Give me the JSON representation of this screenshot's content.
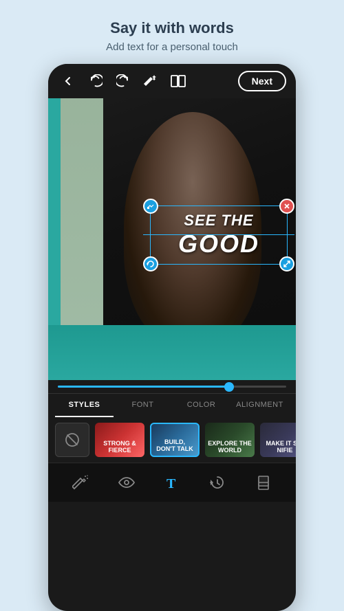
{
  "header": {
    "title": "Say it with words",
    "subtitle": "Add text for a personal touch"
  },
  "toolbar": {
    "back_label": "←",
    "undo_label": "↩",
    "redo_label": "↪",
    "magic_label": "✦",
    "compare_label": "⧉",
    "next_label": "Next"
  },
  "text_overlay": {
    "line1": "SEE THE",
    "line2": "GOOD"
  },
  "slider": {
    "value": 75
  },
  "tabs": [
    {
      "id": "styles",
      "label": "STYLES",
      "active": true
    },
    {
      "id": "font",
      "label": "FONT",
      "active": false
    },
    {
      "id": "color",
      "label": "COLOR",
      "active": false
    },
    {
      "id": "alignment",
      "label": "ALIGNMENT",
      "active": false
    }
  ],
  "style_cards": [
    {
      "id": "none",
      "type": "none",
      "label": ""
    },
    {
      "id": "strong-fierce",
      "type": "card",
      "bg": "1",
      "text": "STRONG &\nFIERCE"
    },
    {
      "id": "build-dont-talk",
      "type": "card",
      "bg": "2",
      "text": "BUILD,\nDON'T TALK",
      "active": true
    },
    {
      "id": "explore-world",
      "type": "card",
      "bg": "3",
      "text": "EXPLORE\nTHE WORLD"
    },
    {
      "id": "make-it",
      "type": "card",
      "bg": "4",
      "text": "MAKE IT SIG\nNIFIE"
    }
  ],
  "bottom_nav": [
    {
      "id": "magic-wand",
      "icon": "wand",
      "active": false
    },
    {
      "id": "eye",
      "icon": "eye",
      "active": false
    },
    {
      "id": "text",
      "icon": "text",
      "active": true
    },
    {
      "id": "history",
      "icon": "history",
      "active": false
    },
    {
      "id": "layers",
      "icon": "layers",
      "active": false
    }
  ],
  "icons": {
    "back": "←",
    "undo": "↩",
    "redo": "↪",
    "edit": "✎",
    "close": "✕",
    "rotate": "↻",
    "resize": "⤢",
    "no_style": "⊘",
    "wand": "✦",
    "eye": "👁",
    "text": "T",
    "history": "⟳",
    "layers": "▨"
  }
}
